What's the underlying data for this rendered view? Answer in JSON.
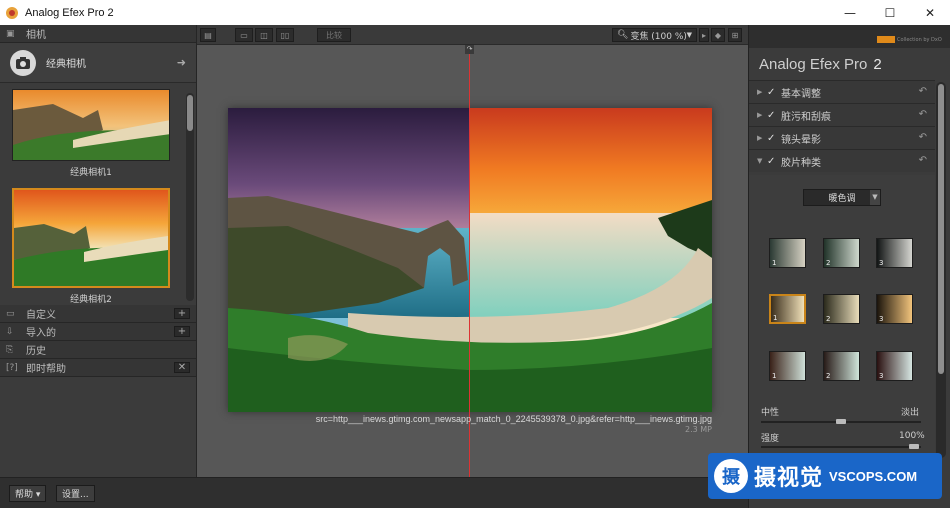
{
  "window": {
    "title": "Analog Efex Pro 2",
    "controls": [
      "—",
      "☐",
      "✕"
    ]
  },
  "left_panel": {
    "header": "相机",
    "preset_group": "经典相机",
    "thumbnails": [
      {
        "caption": "经典相机1",
        "selected": false
      },
      {
        "caption": "经典相机2",
        "selected": true
      }
    ],
    "sections": [
      {
        "label": "自定义",
        "action": "+"
      },
      {
        "label": "导入的",
        "action": "+"
      },
      {
        "label": "历史",
        "action": ""
      },
      {
        "label": "即时帮助",
        "action": "✕"
      }
    ]
  },
  "toolbar": {
    "compare_label": "比较",
    "zoom_label": "变焦 (100 %)"
  },
  "canvas": {
    "filename": "src=http___inews.gtimg.com_newsapp_match_0_2245539378_0.jpg&refer=http___inews.gtimg.jpg",
    "megapixels": "2.3 MP"
  },
  "right_panel": {
    "brand_sub": "Collection by DxO",
    "app_name": "Analog Efex Pro",
    "app_version": "2",
    "filters": [
      {
        "label": "基本调整",
        "checked": true,
        "expanded": false
      },
      {
        "label": "脏污和刮痕",
        "checked": true,
        "expanded": false
      },
      {
        "label": "镜头晕影",
        "checked": true,
        "expanded": false
      },
      {
        "label": "胶片种类",
        "checked": true,
        "expanded": true
      }
    ],
    "film_dropdown": "暖色调",
    "swatches": [
      {
        "num": "1",
        "from": "#2b3a34",
        "to": "#d6d1c2"
      },
      {
        "num": "2",
        "from": "#213329",
        "to": "#cfd8cd"
      },
      {
        "num": "3",
        "from": "#121515",
        "to": "#d5d5d0"
      },
      {
        "num": "1",
        "from": "#3a2e1c",
        "to": "#f0e0b8",
        "selected": true
      },
      {
        "num": "2",
        "from": "#2b2a1c",
        "to": "#e9ddba"
      },
      {
        "num": "3",
        "from": "#1b140c",
        "to": "#f2c47c"
      },
      {
        "num": "1",
        "from": "#3a2219",
        "to": "#cfe0d8"
      },
      {
        "num": "2",
        "from": "#281b18",
        "to": "#cfe4da"
      },
      {
        "num": "3",
        "from": "#2a1010",
        "to": "#d6e6e2"
      }
    ],
    "fade_left": "中性",
    "fade_right": "淡出",
    "fade_value": 0.5,
    "strength_label": "强度",
    "strength_value": "100%"
  },
  "bottom_bar": {
    "help_label": "帮助 ▾",
    "settings_label": "设置..."
  },
  "watermark": {
    "glyph": "摄",
    "cn": "摄视觉",
    "en": "VSCOPS.COM"
  }
}
